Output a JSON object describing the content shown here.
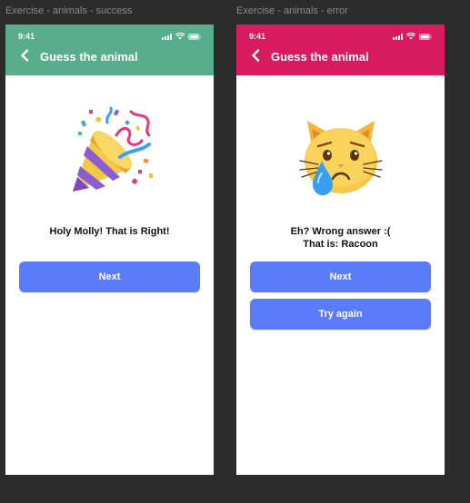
{
  "frames": [
    {
      "label": "Exercise - animals - success",
      "status_time": "9:41",
      "header_title": "Guess the animal",
      "header_color": "#58ad8c",
      "illustration": "party-popper-icon",
      "message_line1": "Holy Molly! That is Right!",
      "message_line2": "",
      "next_label": "Next"
    },
    {
      "label": "Exercise - animals - error",
      "status_time": "9:41",
      "header_title": "Guess the animal",
      "header_color": "#d81b5f",
      "illustration": "crying-cat-icon",
      "message_line1": "Eh? Wrong answer :(",
      "message_line2": "That is: Racoon",
      "next_label": "Next",
      "try_again_label": "Try again"
    }
  ],
  "colors": {
    "canvas": "#2c2c2c",
    "button": "#5b7cfa"
  }
}
